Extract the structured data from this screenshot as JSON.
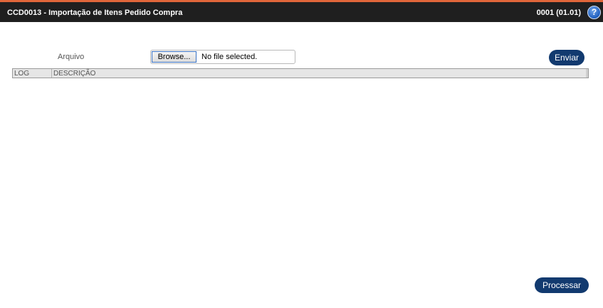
{
  "header": {
    "title": "CCD0013 - Importação de Itens Pedido Compra",
    "version": "0001 (01.01)",
    "help_icon": "question-mark-icon",
    "help_glyph": "?",
    "accent_color": "#e0663a",
    "bar_color": "#1f1f1f"
  },
  "form": {
    "file_label": "Arquivo",
    "browse_label": "Browse...",
    "file_status": "No file selected.",
    "send_label": "Enviar"
  },
  "grid": {
    "columns": [
      "LOG",
      "DESCRIÇÃO"
    ],
    "rows": []
  },
  "footer": {
    "process_label": "Processar"
  },
  "colors": {
    "button_primary": "#123a6f"
  }
}
